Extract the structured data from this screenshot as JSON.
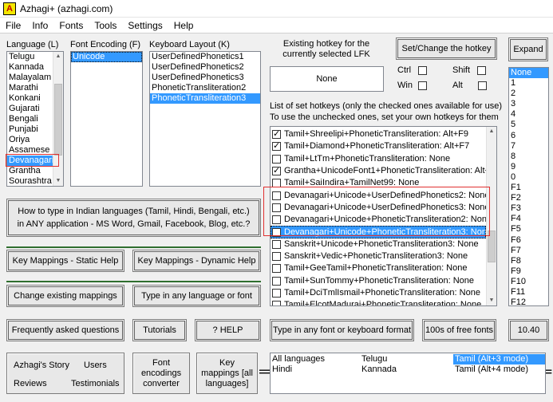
{
  "window": {
    "title": "Azhagi+ (azhagi.com)"
  },
  "menu": [
    "File",
    "Info",
    "Fonts",
    "Tools",
    "Settings",
    "Help"
  ],
  "language": {
    "label": "Language (L)",
    "items": [
      "Telugu",
      "Kannada",
      "Malayalam",
      "Marathi",
      "Konkani",
      "Gujarati",
      "Bengali",
      "Punjabi",
      "Oriya",
      "Assamese",
      "Devanagari",
      "Grantha",
      "Sourashtra"
    ],
    "selected": "Devanagari"
  },
  "font_encoding": {
    "label": "Font Encoding (F)",
    "items": [
      "Unicode"
    ],
    "selected": "Unicode"
  },
  "keyboard_layout": {
    "label": "Keyboard Layout (K)",
    "items": [
      "UserDefinedPhonetics1",
      "UserDefinedPhonetics2",
      "UserDefinedPhonetics3",
      "PhoneticTransliteration2",
      "PhoneticTransliteration3"
    ],
    "selected": "PhoneticTransliteration3"
  },
  "hotkey": {
    "existing_label": "Existing hotkey for the currently selected LFK",
    "existing_value": "None",
    "set_button": "Set/Change the hotkey",
    "ctrl": "Ctrl",
    "win": "Win",
    "shift": "Shift",
    "alt": "Alt",
    "expand_button": "Expand",
    "list_label_1": "List of set hotkeys (only the checked ones available for use)",
    "list_label_2": "To use the unchecked ones, set your own hotkeys for them"
  },
  "hotkey_list": [
    {
      "text": "Tamil+Shreelipi+PhoneticTransliteration: Alt+F9",
      "checked": true
    },
    {
      "text": "Tamil+Diamond+PhoneticTransliteration: Alt+F7",
      "checked": true
    },
    {
      "text": "Tamil+LtTm+PhoneticTransliteration: None",
      "checked": false
    },
    {
      "text": "Grantha+UnicodeFont1+PhoneticTransliteration: Alt+I",
      "checked": true
    },
    {
      "text": "Tamil+SaiIndira+TamilNet99: None",
      "checked": false
    },
    {
      "text": "Devanagari+Unicode+UserDefinedPhonetics2: None",
      "checked": false
    },
    {
      "text": "Devanagari+Unicode+UserDefinedPhonetics3: None",
      "checked": false
    },
    {
      "text": "Devanagari+Unicode+PhoneticTransliteration2: None",
      "checked": false
    },
    {
      "text": "Devanagari+Unicode+PhoneticTransliteration3: None",
      "checked": false
    },
    {
      "text": "Sanskrit+Unicode+PhoneticTransliteration3: None",
      "checked": false
    },
    {
      "text": "Sanskrit+Vedic+PhoneticTransliteration3: None",
      "checked": false
    },
    {
      "text": "Tamil+GeeTamil+PhoneticTransliteration: None",
      "checked": false
    },
    {
      "text": "Tamil+SunTommy+PhoneticTransliteration: None",
      "checked": false
    },
    {
      "text": "Tamil+DciTmlIsmail+PhoneticTransliteration: None",
      "checked": false
    },
    {
      "text": "Tamil+ElcotMadurai+PhoneticTransliteration: None",
      "checked": false
    }
  ],
  "key_list": [
    "None",
    "1",
    "2",
    "3",
    "4",
    "5",
    "6",
    "7",
    "8",
    "9",
    "0",
    "F1",
    "F2",
    "F3",
    "F4",
    "F5",
    "F6",
    "F7",
    "F8",
    "F9",
    "F10",
    "F11",
    "F12"
  ],
  "buttons": {
    "how_to_type_1": "How to type in Indian languages (Tamil, Hindi, Bengali, etc.)",
    "how_to_type_2": "in ANY application - MS Word, Gmail, Facebook, Blog, etc.?",
    "key_mappings_static": "Key Mappings - Static Help",
    "key_mappings_dynamic": "Key Mappings - Dynamic Help",
    "change_mappings": "Change existing mappings",
    "type_any_language": "Type in any language or font",
    "faq": "Frequently asked questions",
    "tutorials": "Tutorials",
    "help": "?  HELP",
    "type_any_font": "Type in any font or keyboard format",
    "free_fonts": "100s of free fonts",
    "version": "10.40",
    "story": "Azhagi's Story",
    "users": "Users",
    "reviews": "Reviews",
    "testimonials": "Testimonials",
    "font_converter": "Font encodings converter",
    "key_mappings_all": "Key mappings [all languages]"
  },
  "bottom_list": {
    "col1": [
      "All languages",
      "Hindi"
    ],
    "col2": [
      "Telugu",
      "Kannada"
    ],
    "col3": [
      "Tamil (Alt+3 mode)",
      "Tamil (Alt+4 mode)"
    ],
    "selected": "Tamil (Alt+3 mode)"
  }
}
